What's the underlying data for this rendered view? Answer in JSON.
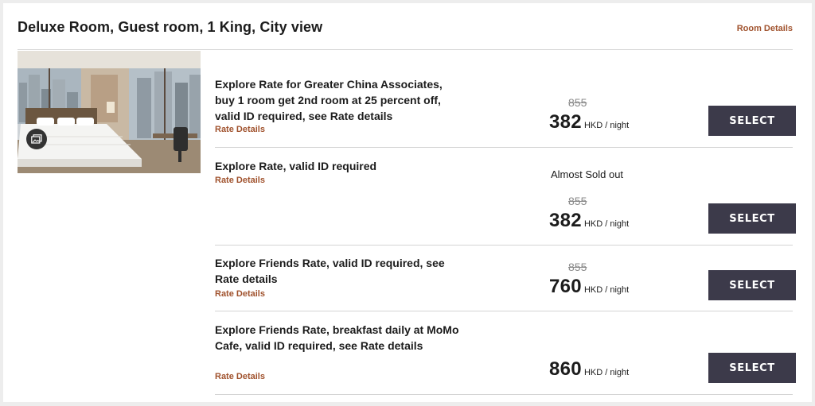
{
  "room": {
    "title": "Deluxe Room, Guest room, 1 King, City view",
    "details_link": "Room Details",
    "photo_icon": "gallery-icon"
  },
  "colors": {
    "link": "#a0522d",
    "button_bg": "#3c3a4a",
    "divider": "#d4d4d4"
  },
  "rates": [
    {
      "description": "Explore Rate for Greater China Associates, buy 1 room get 2nd room at 25 percent off, valid ID required, see Rate details",
      "details_link": "Rate Details",
      "availability": "",
      "old_price": "855",
      "price": "382",
      "unit": "HKD / night",
      "button": "SELECT"
    },
    {
      "description": "Explore Rate, valid ID required",
      "details_link": "Rate Details",
      "availability": "Almost Sold out",
      "old_price": "855",
      "price": "382",
      "unit": "HKD / night",
      "button": "SELECT"
    },
    {
      "description": "Explore Friends Rate, valid ID required, see Rate details",
      "details_link": "Rate Details",
      "availability": "",
      "old_price": "855",
      "price": "760",
      "unit": "HKD / night",
      "button": "SELECT"
    },
    {
      "description": "Explore Friends Rate, breakfast daily at MoMo Cafe, valid ID required, see Rate details",
      "details_link": "Rate Details",
      "availability": "",
      "old_price": "",
      "price": "860",
      "unit": "HKD / night",
      "button": "SELECT"
    }
  ]
}
